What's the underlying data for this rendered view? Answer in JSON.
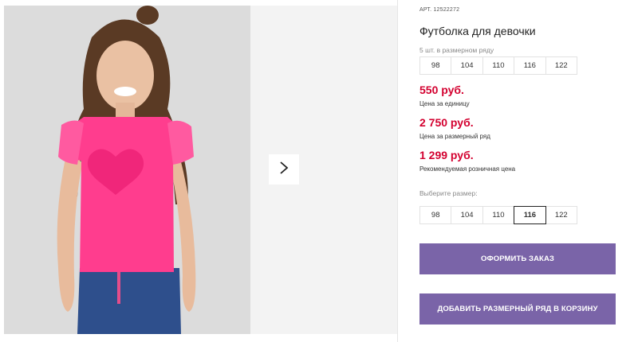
{
  "product": {
    "article_label": "АРТ.",
    "article_number": "12522272",
    "title": "Футболка для девочки",
    "pack_count": "5 шт. в размерном ряду",
    "pack_sizes": [
      "98",
      "104",
      "110",
      "116",
      "122"
    ]
  },
  "prices": {
    "unit_price": "550 руб.",
    "unit_label": "Цена за единицу",
    "pack_price": "2 750 руб.",
    "pack_label": "Цена за размерный ряд",
    "retail_price": "1 299 руб.",
    "retail_label": "Рекомендуемая розничная цена"
  },
  "size_picker": {
    "label": "Выберите размер:",
    "options": [
      "98",
      "104",
      "110",
      "116",
      "122"
    ],
    "selected": "116"
  },
  "actions": {
    "order_label": "ОФОРМИТЬ ЗАКАЗ",
    "add_pack_label": "ДОБАВИТЬ РАЗМЕРНЫЙ РЯД В КОРЗИНУ"
  },
  "colors": {
    "price_red": "#d3002f",
    "button_purple": "#7a64a8",
    "shirt_pink": "#ff3d8e"
  },
  "gallery": {
    "next_icon": "chevron-right-icon"
  }
}
